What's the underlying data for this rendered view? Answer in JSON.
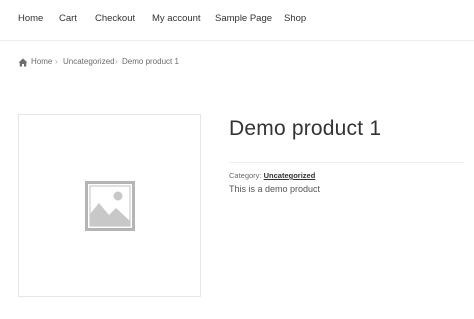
{
  "nav": {
    "items": [
      {
        "label": "Home"
      },
      {
        "label": "Cart"
      },
      {
        "label": "Checkout"
      },
      {
        "label": "My account"
      },
      {
        "label": "Sample Page"
      },
      {
        "label": "Shop"
      }
    ]
  },
  "breadcrumb": {
    "home": "Home",
    "category": "Uncategorized",
    "current": "Demo product 1",
    "separator": "›",
    "home_icon": "home-icon"
  },
  "product": {
    "title": "Demo product 1",
    "category_label": "Category:",
    "category": "Uncategorized",
    "description": "This is a demo product",
    "image_icon": "image-placeholder-icon"
  }
}
